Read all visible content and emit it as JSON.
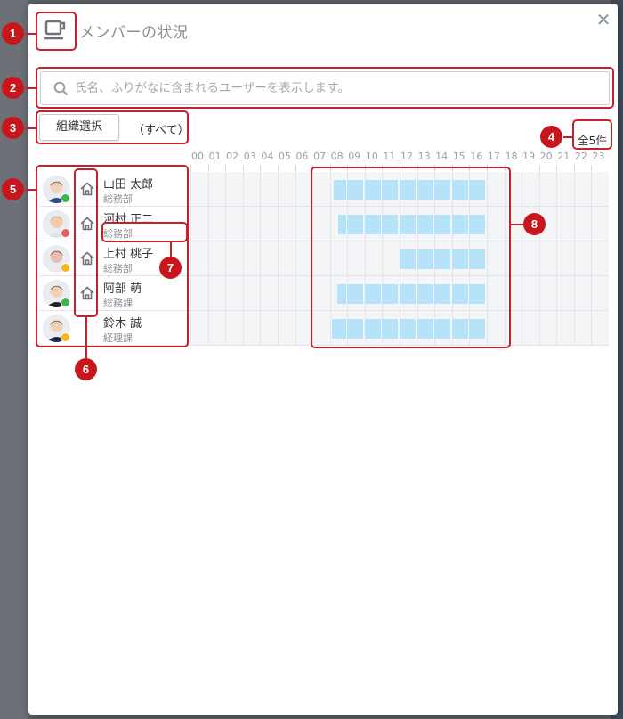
{
  "dialog": {
    "title": "メンバーの状況",
    "close_icon": "close-icon",
    "title_icon": "coffee-cup-icon"
  },
  "search": {
    "placeholder": "氏名、ふりがなに含まれるユーザーを表示します。",
    "value": ""
  },
  "filter": {
    "org_button_label": "組織選択",
    "org_selected": "（すべて）"
  },
  "total_count": "全5件",
  "hours": [
    "00",
    "01",
    "02",
    "03",
    "04",
    "05",
    "06",
    "07",
    "08",
    "09",
    "10",
    "11",
    "12",
    "13",
    "14",
    "15",
    "16",
    "17",
    "18",
    "19",
    "20",
    "21",
    "22",
    "23"
  ],
  "members": [
    {
      "name": "山田 太郎",
      "dept": "総務部",
      "status": "present",
      "home_icon": true
    },
    {
      "name": "河村 正二",
      "dept": "総務部",
      "status": "absent",
      "home_icon": true
    },
    {
      "name": "上村 桃子",
      "dept": "総務部",
      "status": "away",
      "home_icon": true
    },
    {
      "name": "阿部 萌",
      "dept": "総務課",
      "status": "present",
      "home_icon": true
    },
    {
      "name": "鈴木 誠",
      "dept": "経理課",
      "status": "away",
      "home_icon": false
    }
  ],
  "schedule_hours": [
    {
      "start": 8.2,
      "end": 17
    },
    {
      "start": 8.5,
      "end": 17
    },
    {
      "start": 12,
      "end": 17
    },
    {
      "start": 8.4,
      "end": 17
    },
    {
      "start": 8.1,
      "end": 17
    }
  ],
  "status_colors": {
    "present": "#3cb54a",
    "absent": "#e85c5c",
    "away": "#f2b81a"
  },
  "bar_color": "#b6e3f9",
  "callouts": [
    "1",
    "2",
    "3",
    "4",
    "5",
    "6",
    "7",
    "8"
  ]
}
